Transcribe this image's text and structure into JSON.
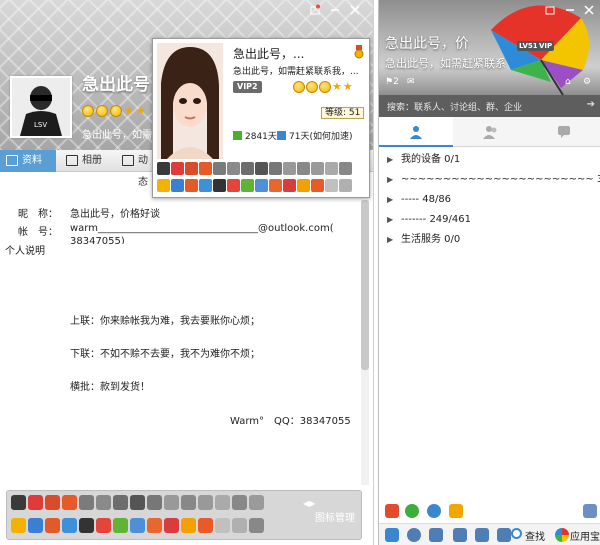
{
  "profile_window": {
    "nickname": "急出此号，价",
    "signature": "急出此号，如需",
    "tabs": [
      "资料",
      "相册",
      "动态"
    ],
    "fields": [
      {
        "label": "昵　称：",
        "value": "急出此号，价格好谈"
      },
      {
        "label": "帐　号：",
        "value": "warm________________________________@outlook.com("
      },
      {
        "label": "",
        "value": "38347055)"
      },
      {
        "label": "个人说明",
        "value": ""
      }
    ],
    "description_lines": [
      "上联：你来赊帐我为难，我去要账你心烦；",
      "下联：不如不赊不去要，我不为难你不烦；",
      "横批：款到发货！"
    ],
    "footer": "Warm°　QQ：38347055",
    "sticker_manage": "图标管理",
    "colors": {
      "accent": "#5a9ed6"
    }
  },
  "popup": {
    "nickname": "急出此号，...",
    "signature": "急出此号，如需赶紧联系我，...",
    "vip": "VIP2",
    "level": "等级: 51",
    "days_active": "2841天",
    "days_speedup": "71天(如何加速)"
  },
  "main_panel": {
    "nickname": "急出此号，价",
    "signature": "急出此号，如需赶紧联系",
    "level_badge": "LV51",
    "vip_badge": "VIP",
    "msg_count": "2",
    "search_placeholder": "搜索：联系人、讨论组、群、企业",
    "groups": [
      {
        "label": "我的设备 0/1"
      },
      {
        "label": "~~~~~~~~~~~~~~~~~~~~~~~ 34/45"
      },
      {
        "label": "----- 48/86"
      },
      {
        "label": "------- 249/461"
      },
      {
        "label": "生活服务 0/0"
      }
    ],
    "bottom": {
      "search_label": "查找",
      "app_label": "应用宝"
    }
  }
}
